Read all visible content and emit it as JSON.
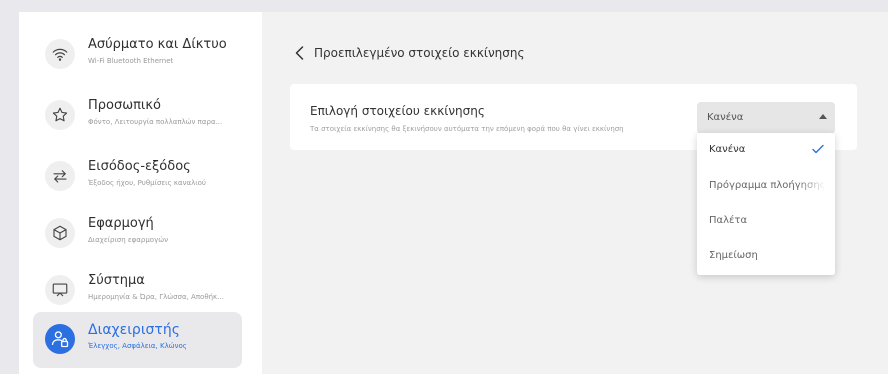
{
  "sidebar": {
    "items": [
      {
        "title": "Ασύρματο και Δίκτυο",
        "subtitle": "Wi-Fi Bluetooth Ethernet",
        "icon": "wifi-icon"
      },
      {
        "title": "Προσωπικό",
        "subtitle": "Φόντο, Λειτουργία πολλαπλών παρα...",
        "icon": "star-icon"
      },
      {
        "title": "Εισόδος-εξόδος",
        "subtitle": "Έξοδος ήχου, Ρυθμίσεις καναλιού",
        "icon": "arrows-icon"
      },
      {
        "title": "Εφαρμογή",
        "subtitle": "Διαχείριση εφαρμογών",
        "icon": "cube-icon"
      },
      {
        "title": "Σύστημα",
        "subtitle": "Ημερομηνία & Ώρα, Γλώσσα, Αποθήκ...",
        "icon": "monitor-icon"
      },
      {
        "title": "Διαχειριστής",
        "subtitle": "Έλεγχος, Ασφάλεια, Κλώνος",
        "icon": "admin-lock-icon",
        "active": true
      }
    ]
  },
  "header": {
    "back_title": "Προεπιλεγμένο στοιχείο εκκίνησης"
  },
  "setting": {
    "title": "Επιλογή στοιχείου εκκίνησης",
    "description": "Τα στοιχεία εκκίνησης θα ξεκινήσουν αυτόματα την επόμενη φορά που θα γίνει εκκίνηση",
    "selected_value": "Κανένα"
  },
  "dropdown": {
    "options": [
      {
        "label": "Κανένα",
        "selected": true
      },
      {
        "label": "Πρόγραμμα πλοήγησης"
      },
      {
        "label": "Παλέτα"
      },
      {
        "label": "Σημείωση"
      }
    ]
  },
  "colors": {
    "accent": "#2b6fe0",
    "sidebar_bg": "#ffffff",
    "content_bg": "#f2f2f2",
    "active_item_bg": "#e9e9ec"
  }
}
